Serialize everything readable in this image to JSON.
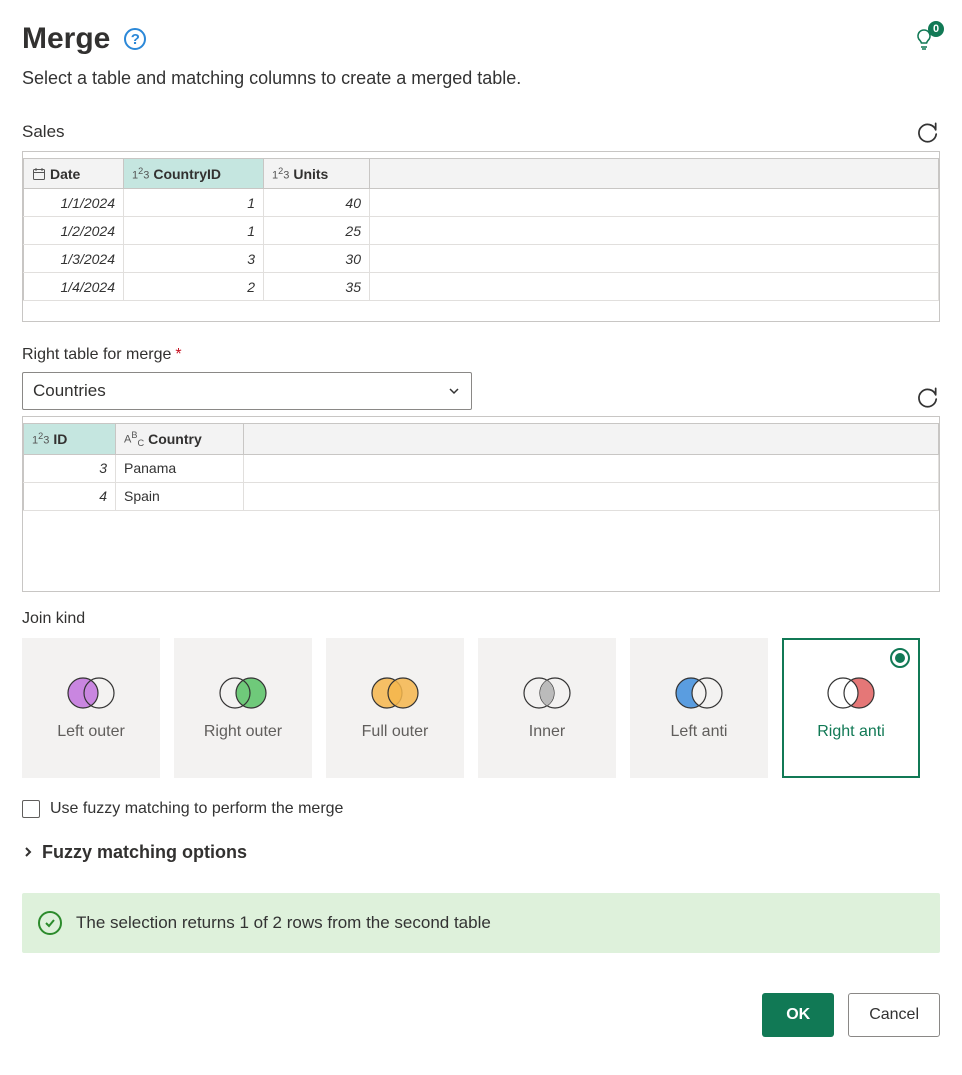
{
  "header": {
    "title": "Merge",
    "tips_badge": "0"
  },
  "subtitle": "Select a table and matching columns to create a merged table.",
  "left_table": {
    "name": "Sales",
    "columns": [
      {
        "label": "Date",
        "type": "date",
        "selected": false
      },
      {
        "label": "CountryID",
        "type": "number",
        "selected": true
      },
      {
        "label": "Units",
        "type": "number",
        "selected": false
      }
    ],
    "rows": [
      {
        "c0": "1/1/2024",
        "c1": "1",
        "c2": "40"
      },
      {
        "c0": "1/2/2024",
        "c1": "1",
        "c2": "25"
      },
      {
        "c0": "1/3/2024",
        "c1": "3",
        "c2": "30"
      },
      {
        "c0": "1/4/2024",
        "c1": "2",
        "c2": "35"
      }
    ]
  },
  "right_table_label": "Right table for merge",
  "right_table_dropdown": "Countries",
  "right_table": {
    "columns": [
      {
        "label": "ID",
        "type": "number",
        "selected": true
      },
      {
        "label": "Country",
        "type": "text",
        "selected": false
      }
    ],
    "rows": [
      {
        "c0": "3",
        "c1": "Panama"
      },
      {
        "c0": "4",
        "c1": "Spain"
      }
    ]
  },
  "join_kind_label": "Join kind",
  "join_kinds": [
    {
      "label": "Left outer"
    },
    {
      "label": "Right outer"
    },
    {
      "label": "Full outer"
    },
    {
      "label": "Inner"
    },
    {
      "label": "Left anti"
    },
    {
      "label": "Right anti"
    }
  ],
  "selected_join_index": 5,
  "fuzzy_checkbox_label": "Use fuzzy matching to perform the merge",
  "fuzzy_options_label": "Fuzzy matching options",
  "status_message": "The selection returns 1 of 2 rows from the second table",
  "buttons": {
    "ok": "OK",
    "cancel": "Cancel"
  }
}
